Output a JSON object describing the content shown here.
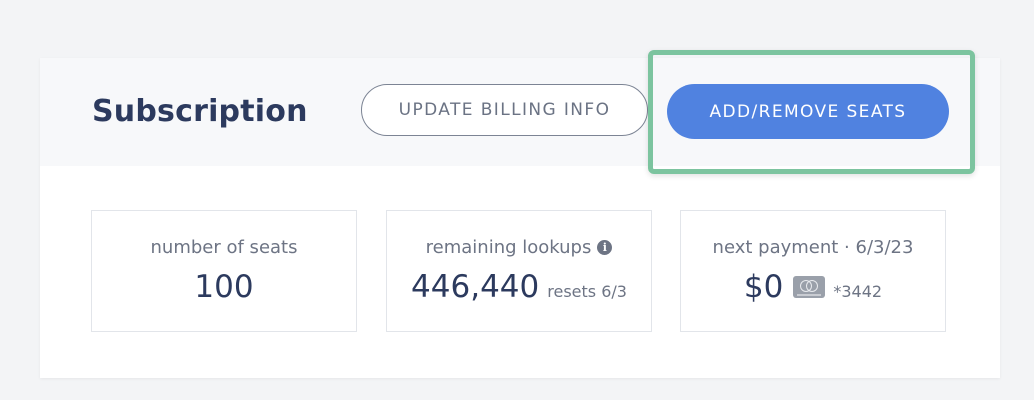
{
  "subscription": {
    "title": "Subscription",
    "update_billing_label": "UPDATE BILLING INFO",
    "add_remove_seats_label": "ADD/REMOVE SEATS"
  },
  "stats": {
    "seats": {
      "label": "number of seats",
      "value": "100"
    },
    "lookups": {
      "label": "remaining lookups",
      "info_icon": "info-icon",
      "value": "446,440",
      "sub": "resets 6/3"
    },
    "payment": {
      "label": "next payment · 6/3/23",
      "value": "$0",
      "card_icon": "mastercard-icon",
      "card_last4": "*3442"
    }
  },
  "colors": {
    "primary": "#5082e0",
    "highlight": "#7cc49f",
    "title": "#2c3a5e",
    "muted": "#6d7484"
  }
}
